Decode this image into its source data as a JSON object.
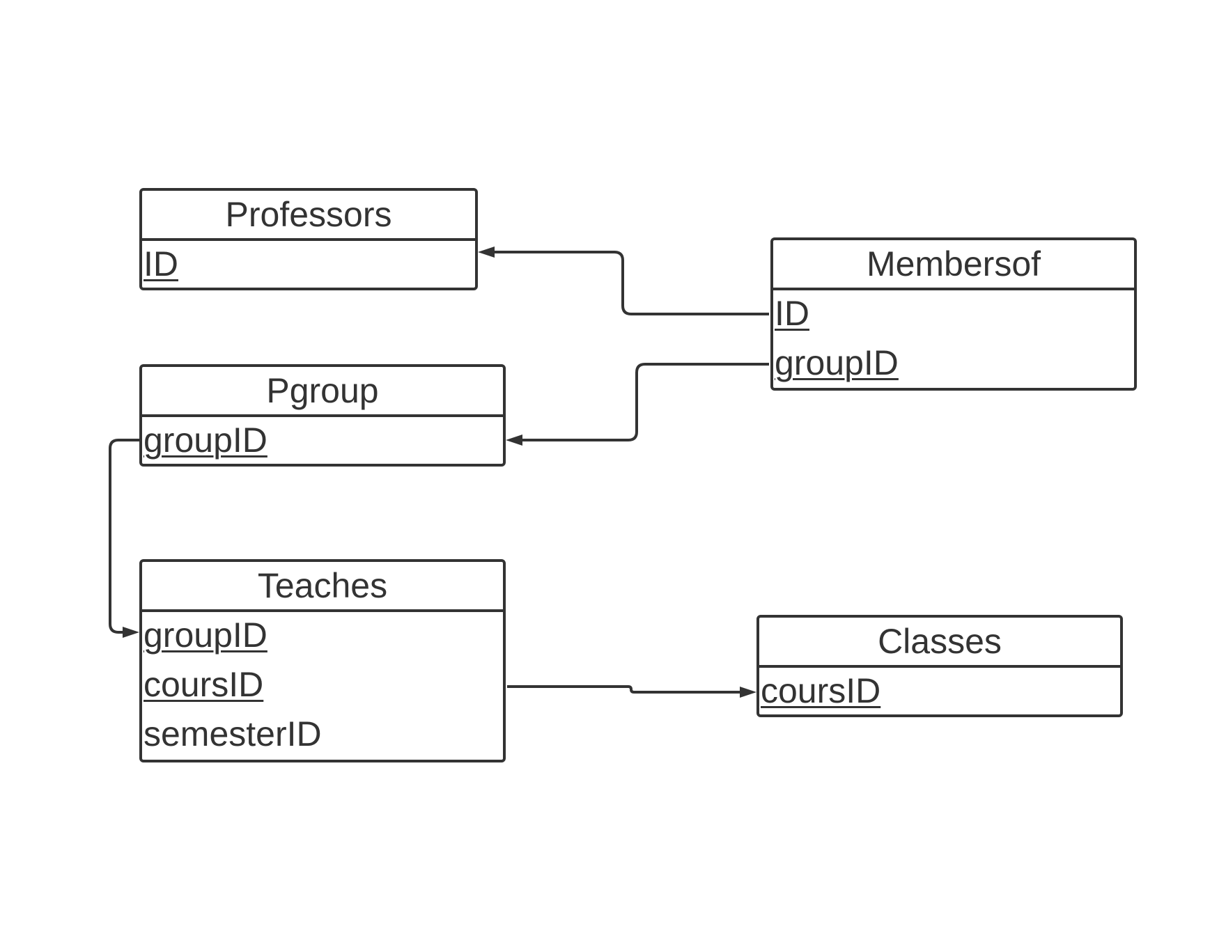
{
  "diagram": {
    "entities": {
      "professors": {
        "title": "Professors",
        "attributes": [
          {
            "name": "ID",
            "key": true
          }
        ]
      },
      "membersof": {
        "title": "Membersof",
        "attributes": [
          {
            "name": "ID",
            "key": true
          },
          {
            "name": "groupID",
            "key": true
          }
        ]
      },
      "pgroup": {
        "title": "Pgroup",
        "attributes": [
          {
            "name": "groupID",
            "key": true
          }
        ]
      },
      "teaches": {
        "title": "Teaches",
        "attributes": [
          {
            "name": "groupID",
            "key": true
          },
          {
            "name": "coursID",
            "key": true
          },
          {
            "name": "semesterID",
            "key": false
          }
        ]
      },
      "classes": {
        "title": "Classes",
        "attributes": [
          {
            "name": "coursID",
            "key": true
          }
        ]
      }
    },
    "relationships": [
      {
        "from": "Membersof.ID",
        "to": "Professors.ID"
      },
      {
        "from": "Membersof.groupID",
        "to": "Pgroup.groupID"
      },
      {
        "from": "Pgroup.groupID",
        "to": "Teaches.groupID"
      },
      {
        "from": "Teaches.coursID",
        "to": "Classes.coursID"
      }
    ],
    "colors": {
      "line": "#333333",
      "background": "#ffffff"
    }
  }
}
